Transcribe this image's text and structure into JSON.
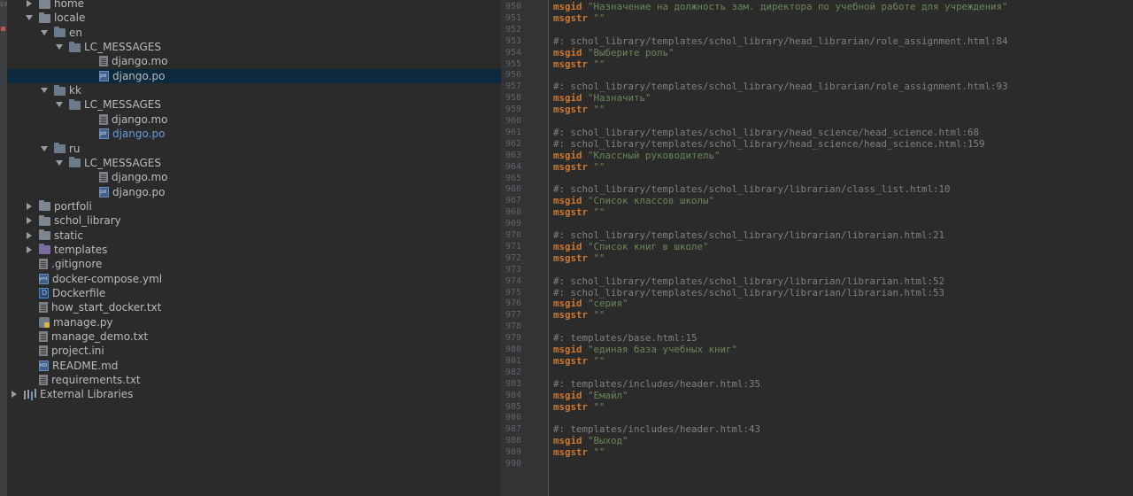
{
  "tree": {
    "rows": [
      {
        "depth": 1,
        "arrow": "right",
        "icon": "folder",
        "label": "home"
      },
      {
        "depth": 1,
        "arrow": "down",
        "icon": "folder",
        "label": "locale"
      },
      {
        "depth": 2,
        "arrow": "down",
        "icon": "folder",
        "label": "en"
      },
      {
        "depth": 3,
        "arrow": "down",
        "icon": "folder",
        "label": "LC_MESSAGES"
      },
      {
        "depth": 4,
        "arrow": "none",
        "icon": "file",
        "label": "django.mo"
      },
      {
        "depth": 4,
        "arrow": "none",
        "icon": "po",
        "label": "django.po",
        "selected": true
      },
      {
        "depth": 2,
        "arrow": "down",
        "icon": "folder",
        "label": "kk"
      },
      {
        "depth": 3,
        "arrow": "down",
        "icon": "folder",
        "label": "LC_MESSAGES"
      },
      {
        "depth": 4,
        "arrow": "none",
        "icon": "file",
        "label": "django.mo"
      },
      {
        "depth": 4,
        "arrow": "none",
        "icon": "po",
        "label": "django.po",
        "modified": true
      },
      {
        "depth": 2,
        "arrow": "down",
        "icon": "folder",
        "label": "ru"
      },
      {
        "depth": 3,
        "arrow": "down",
        "icon": "folder",
        "label": "LC_MESSAGES"
      },
      {
        "depth": 4,
        "arrow": "none",
        "icon": "file",
        "label": "django.mo"
      },
      {
        "depth": 4,
        "arrow": "none",
        "icon": "po",
        "label": "django.po"
      },
      {
        "depth": 1,
        "arrow": "right",
        "icon": "folder",
        "label": "portfoli"
      },
      {
        "depth": 1,
        "arrow": "right",
        "icon": "folder",
        "label": "schol_library"
      },
      {
        "depth": 1,
        "arrow": "right",
        "icon": "folder",
        "label": "static"
      },
      {
        "depth": 1,
        "arrow": "right",
        "icon": "folder-purple",
        "label": "templates"
      },
      {
        "depth": 1,
        "arrow": "none",
        "icon": "file",
        "label": ".gitignore"
      },
      {
        "depth": 1,
        "arrow": "none",
        "icon": "yml",
        "label": "docker-compose.yml"
      },
      {
        "depth": 1,
        "arrow": "none",
        "icon": "docker",
        "label": "Dockerfile"
      },
      {
        "depth": 1,
        "arrow": "none",
        "icon": "file",
        "label": "how_start_docker.txt"
      },
      {
        "depth": 1,
        "arrow": "none",
        "icon": "py",
        "label": "manage.py"
      },
      {
        "depth": 1,
        "arrow": "none",
        "icon": "file",
        "label": "manage_demo.txt"
      },
      {
        "depth": 1,
        "arrow": "none",
        "icon": "file",
        "label": "project.ini"
      },
      {
        "depth": 1,
        "arrow": "none",
        "icon": "md",
        "label": "README.md"
      },
      {
        "depth": 1,
        "arrow": "none",
        "icon": "file",
        "label": "requirements.txt"
      },
      {
        "depth": 0,
        "arrow": "right",
        "icon": "extlib",
        "label": "External Libraries"
      }
    ]
  },
  "editor": {
    "lines": [
      {
        "n": "950",
        "kind": "msgid",
        "text": "\"Назначение на должность зам. директора по учебной работе для учреждения\""
      },
      {
        "n": "951",
        "kind": "msgstr",
        "text": "\"\""
      },
      {
        "n": "952",
        "kind": "blank",
        "text": ""
      },
      {
        "n": "953",
        "kind": "comment",
        "text": "#: schol_library/templates/schol_library/head_librarian/role_assignment.html:84"
      },
      {
        "n": "954",
        "kind": "msgid",
        "text": "\"Выберите роль\""
      },
      {
        "n": "955",
        "kind": "msgstr",
        "text": "\"\""
      },
      {
        "n": "956",
        "kind": "blank",
        "text": ""
      },
      {
        "n": "957",
        "kind": "comment",
        "text": "#: schol_library/templates/schol_library/head_librarian/role_assignment.html:93"
      },
      {
        "n": "958",
        "kind": "msgid",
        "text": "\"Назначить\""
      },
      {
        "n": "959",
        "kind": "msgstr",
        "text": "\"\""
      },
      {
        "n": "960",
        "kind": "blank",
        "text": ""
      },
      {
        "n": "961",
        "kind": "comment",
        "text": "#: schol_library/templates/schol_library/head_science/head_science.html:68"
      },
      {
        "n": "962",
        "kind": "comment",
        "text": "#: schol_library/templates/schol_library/head_science/head_science.html:159"
      },
      {
        "n": "963",
        "kind": "msgid",
        "text": "\"Классный руководитель\""
      },
      {
        "n": "964",
        "kind": "msgstr",
        "text": "\"\""
      },
      {
        "n": "965",
        "kind": "blank",
        "text": ""
      },
      {
        "n": "966",
        "kind": "comment",
        "text": "#: schol_library/templates/schol_library/librarian/class_list.html:10"
      },
      {
        "n": "967",
        "kind": "msgid",
        "text": "\"Список классов школы\""
      },
      {
        "n": "968",
        "kind": "msgstr",
        "text": "\"\""
      },
      {
        "n": "969",
        "kind": "blank",
        "text": ""
      },
      {
        "n": "970",
        "kind": "comment",
        "text": "#: schol_library/templates/schol_library/librarian/librarian.html:21"
      },
      {
        "n": "971",
        "kind": "msgid",
        "text": "\"Список книг в школе\""
      },
      {
        "n": "972",
        "kind": "msgstr",
        "text": "\"\""
      },
      {
        "n": "973",
        "kind": "blank",
        "text": ""
      },
      {
        "n": "974",
        "kind": "comment",
        "text": "#: schol_library/templates/schol_library/librarian/librarian.html:52"
      },
      {
        "n": "975",
        "kind": "comment",
        "text": "#: schol_library/templates/schol_library/librarian/librarian.html:53"
      },
      {
        "n": "976",
        "kind": "msgid",
        "text": "\"серия\""
      },
      {
        "n": "977",
        "kind": "msgstr",
        "text": "\"\""
      },
      {
        "n": "978",
        "kind": "blank",
        "text": ""
      },
      {
        "n": "979",
        "kind": "comment",
        "text": "#: templates/base.html:15"
      },
      {
        "n": "980",
        "kind": "msgid",
        "text": "\"единая база учебных книг\""
      },
      {
        "n": "981",
        "kind": "msgstr",
        "text": "\"\""
      },
      {
        "n": "982",
        "kind": "blank",
        "text": ""
      },
      {
        "n": "983",
        "kind": "comment",
        "text": "#: templates/includes/header.html:35"
      },
      {
        "n": "984",
        "kind": "msgid",
        "text": "\"Емайл\""
      },
      {
        "n": "985",
        "kind": "msgstr",
        "text": "\"\""
      },
      {
        "n": "986",
        "kind": "blank",
        "text": ""
      },
      {
        "n": "987",
        "kind": "comment",
        "text": "#: templates/includes/header.html:43"
      },
      {
        "n": "988",
        "kind": "msgid",
        "text": "\"Выход\""
      },
      {
        "n": "989",
        "kind": "msgstr",
        "text": "\"\""
      },
      {
        "n": "990",
        "kind": "blank",
        "text": ""
      }
    ]
  },
  "colors": {
    "keyword": "#cc7832",
    "string": "#6a8759",
    "comment": "#808080",
    "selection": "#0d293e",
    "modified_label": "#6a9ad8"
  }
}
